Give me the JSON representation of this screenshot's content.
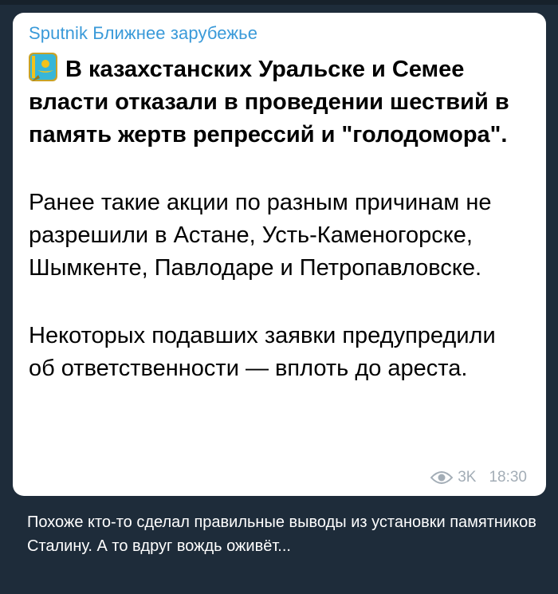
{
  "post": {
    "channel": "Sputnik Ближнее зарубежье",
    "headline": "В казахстанских Уральске и Семее власти отказали в проведении шествий в память жертв репрессий и \"голодомора\".",
    "paragraph1": "Ранее такие акции по разным причинам не разрешили в Астане, Усть-Каменогорске, Шымкенте, Павлодаре и Петропавловске.",
    "paragraph2": "Некоторых подавших заявки предупредили об ответственности — вплоть до ареста.",
    "views": "3K",
    "time": "18:30",
    "flag_icon": "kazakhstan-flag-icon"
  },
  "comment": {
    "text": "Похоже кто-то сделал правильные выводы из установки памятников Сталину. А то вдруг вождь оживёт..."
  },
  "colors": {
    "background": "#1e2c3a",
    "bubble": "#ffffff",
    "channel_name": "#3a9ad9",
    "meta": "#a3adb6",
    "flag_blue": "#37b6d8",
    "flag_gold": "#f2c21a"
  }
}
